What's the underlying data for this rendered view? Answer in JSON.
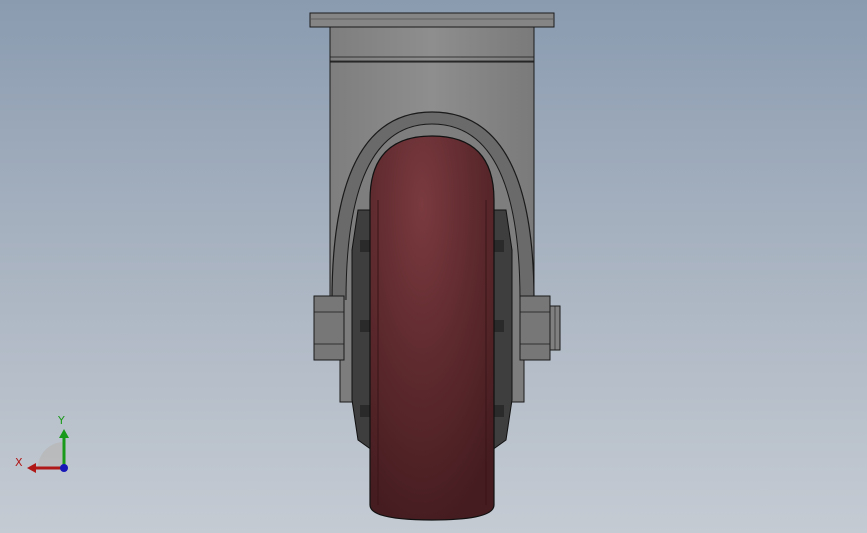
{
  "view": {
    "background_top": "#8a9bb0",
    "background_bottom": "#c5cbd3"
  },
  "model": {
    "bracket_color": "#8a8a8a",
    "wheel_color": "#5e2a2e",
    "hardware_color": "#747474",
    "outline_color": "#1a1a1a"
  },
  "triad": {
    "x_label": "X",
    "y_label": "Y",
    "x_color": "#b01818",
    "y_color": "#1a9a1a",
    "z_color": "#1818b8"
  }
}
